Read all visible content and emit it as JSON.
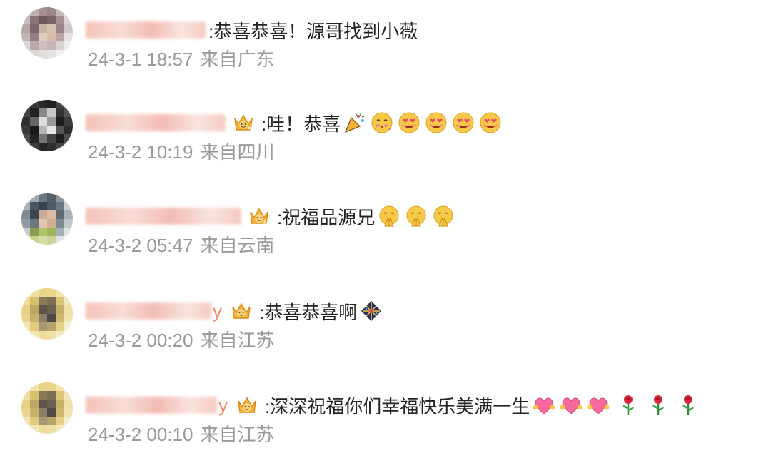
{
  "comments": [
    {
      "content": ":恭喜恭喜！源哥找到小薇",
      "time": "24-3-1 18:57",
      "location": "来自广东",
      "vip": false,
      "name_tail": "",
      "emojis": []
    },
    {
      "content": ":哇！恭喜",
      "time": "24-3-2 10:19",
      "location": "来自四川",
      "vip": true,
      "name_tail": "",
      "emojis": [
        "party-popper-emoji",
        "kiss-blush-emoji",
        "love-eyes-emoji",
        "love-eyes-emoji",
        "love-eyes-emoji",
        "love-eyes-emoji"
      ]
    },
    {
      "content": ":祝福品源兄",
      "time": "24-3-2 05:47",
      "location": "来自云南",
      "vip": true,
      "name_tail": "",
      "emojis": [
        "pray-emoji",
        "pray-emoji",
        "pray-emoji"
      ]
    },
    {
      "content": ":恭喜恭喜啊",
      "time": "24-3-2 00:20",
      "location": "来自江苏",
      "vip": true,
      "name_tail": "y",
      "emojis": [
        "firework-emoji"
      ]
    },
    {
      "content": ":深深祝福你们幸福快乐美满一生",
      "time": "24-3-2 00:10",
      "location": "来自江苏",
      "vip": true,
      "name_tail": "y",
      "emojis": [
        "heart-hug-emoji",
        "heart-hug-emoji",
        "heart-hug-emoji",
        "rose-emoji",
        "rose-emoji",
        "rose-emoji"
      ]
    }
  ],
  "colors": {
    "text": "#222222",
    "meta": "#9a9a9a",
    "username_blur": "#f2b9ad",
    "vip_gold": "#f5b638"
  }
}
